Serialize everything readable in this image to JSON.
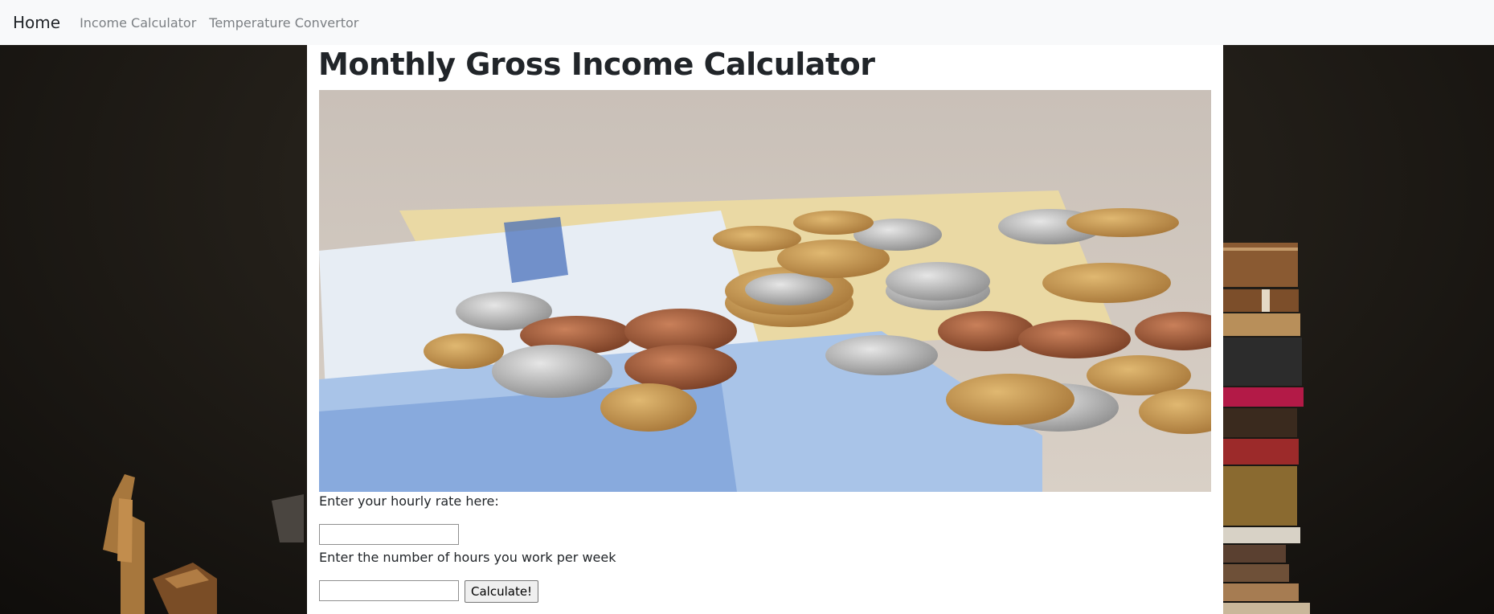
{
  "nav": {
    "brand": "Home",
    "links": [
      "Income Calculator",
      "Temperature Convertor"
    ]
  },
  "main": {
    "title": "Monthly Gross Income Calculator",
    "hero_image": "coins-and-banknotes-photo",
    "hourly_rate_label": "Enter your hourly rate here:",
    "hourly_rate_value": "",
    "hours_label": "Enter the number of hours you work per week",
    "hours_value": "",
    "calculate_label": "Calculate!"
  },
  "colors": {
    "navbar_bg": "#f8f9fa",
    "nav_link": "#7b7f83",
    "text": "#212529",
    "page_bg_dark": "#1a1713"
  }
}
